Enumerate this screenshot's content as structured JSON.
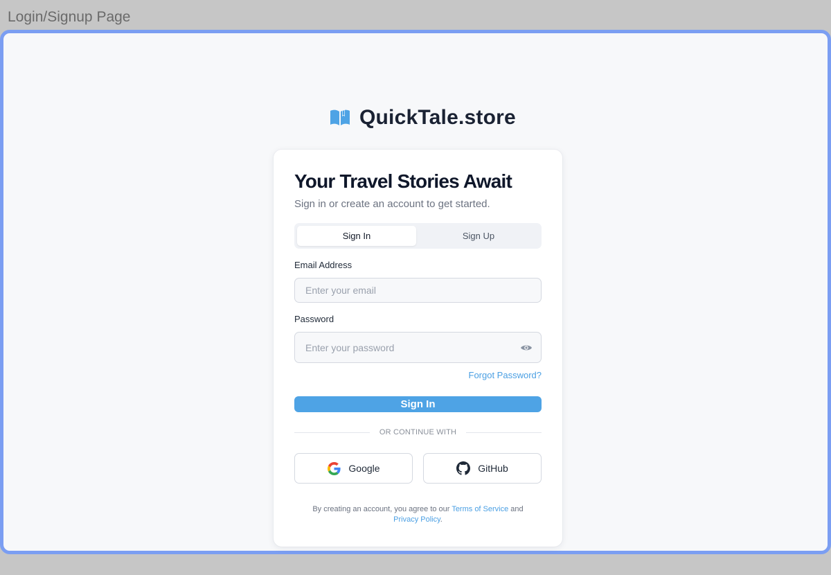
{
  "frame": {
    "label": "Login/Signup Page"
  },
  "brand": {
    "name": "QuickTale.store",
    "icon": "open-book-icon",
    "color": "#4ea3e5"
  },
  "card": {
    "title": "Your Travel Stories Await",
    "subtitle": "Sign in or create an account to get started."
  },
  "tabs": {
    "items": [
      {
        "label": "Sign In",
        "active": true
      },
      {
        "label": "Sign Up",
        "active": false
      }
    ]
  },
  "form": {
    "email": {
      "label": "Email Address",
      "value": "",
      "placeholder": "Enter your email"
    },
    "password": {
      "label": "Password",
      "value": "",
      "placeholder": "Enter your password",
      "toggle_icon": "eye-icon"
    },
    "forgot_label": "Forgot Password?",
    "submit_label": "Sign In"
  },
  "social": {
    "divider_text": "OR CONTINUE WITH",
    "google_label": "Google",
    "google_icon": "google-icon",
    "github_label": "GitHub",
    "github_icon": "github-icon"
  },
  "terms": {
    "prefix": "By creating an account, you agree to our",
    "tos_label": "Terms of Service",
    "middle": "and",
    "privacy_label": "Privacy Policy",
    "suffix": "."
  },
  "colors": {
    "accent": "#4ea3e5",
    "frame_border": "#7b9ef2",
    "title": "#0f172a"
  }
}
